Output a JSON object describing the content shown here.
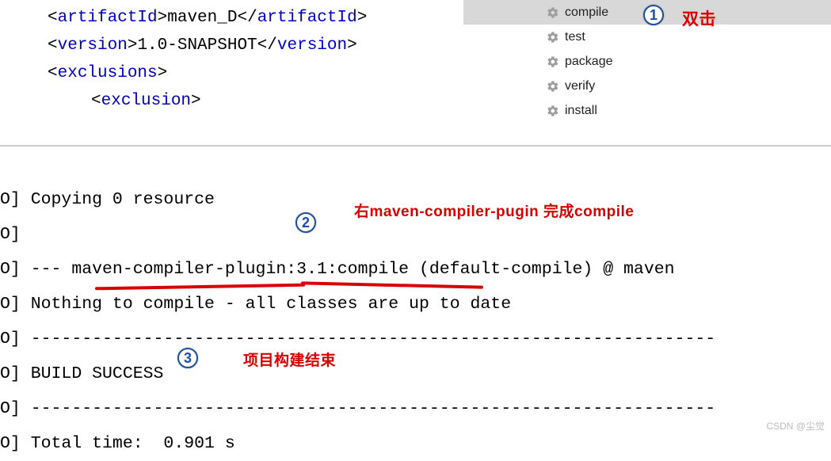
{
  "editor": {
    "lines": [
      {
        "indent": 1,
        "parts": [
          {
            "t": "b",
            "v": "<"
          },
          {
            "t": "n",
            "v": "artifactId"
          },
          {
            "t": "b",
            "v": ">"
          },
          {
            "t": "x",
            "v": "maven_D"
          },
          {
            "t": "b",
            "v": "</"
          },
          {
            "t": "n",
            "v": "artifactId"
          },
          {
            "t": "b",
            "v": ">"
          }
        ]
      },
      {
        "indent": 1,
        "parts": [
          {
            "t": "b",
            "v": "<"
          },
          {
            "t": "n",
            "v": "version"
          },
          {
            "t": "b",
            "v": ">"
          },
          {
            "t": "x",
            "v": "1.0-SNAPSHOT"
          },
          {
            "t": "b",
            "v": "</"
          },
          {
            "t": "n",
            "v": "version"
          },
          {
            "t": "b",
            "v": ">"
          }
        ]
      },
      {
        "indent": 1,
        "parts": [
          {
            "t": "b",
            "v": "<"
          },
          {
            "t": "n",
            "v": "exclusions"
          },
          {
            "t": "b",
            "v": ">"
          }
        ]
      },
      {
        "indent": 2,
        "parts": [
          {
            "t": "b",
            "v": "<"
          },
          {
            "t": "n",
            "v": "exclusion"
          },
          {
            "t": "b",
            "v": ">"
          }
        ]
      }
    ]
  },
  "maven": {
    "items": [
      {
        "label": "compile",
        "selected": true
      },
      {
        "label": "test",
        "selected": false
      },
      {
        "label": "package",
        "selected": false
      },
      {
        "label": "verify",
        "selected": false
      },
      {
        "label": "install",
        "selected": false
      }
    ]
  },
  "callouts": {
    "c1": "1",
    "c2": "2",
    "c3": "3",
    "dblclick": "双击",
    "anno2": "右maven-compiler-pugin 完成compile",
    "anno3": "项目构建结束"
  },
  "console": {
    "rows": [
      "O] Copying 0 resource",
      "O]",
      "O] --- maven-compiler-plugin:3.1:compile (default-compile) @ maven",
      "O] Nothing to compile - all classes are up to date",
      "O] -------------------------------------------------------------------",
      "O] BUILD SUCCESS",
      "O] -------------------------------------------------------------------",
      "O] Total time:  0.901 s"
    ]
  },
  "watermark": "CSDN @尘觉"
}
